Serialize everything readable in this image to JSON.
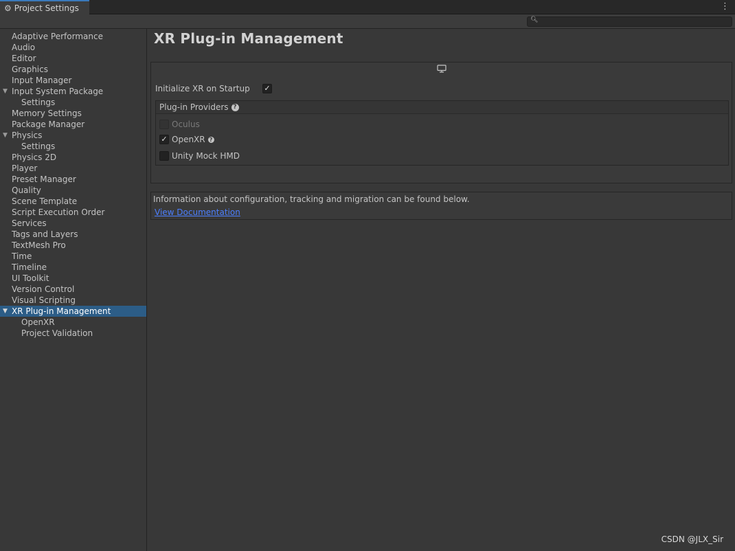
{
  "window": {
    "tab_title": "Project Settings",
    "tab_icon": "gear-icon",
    "menu_icon": "kebab-menu-icon"
  },
  "search": {
    "icon": "search-icon",
    "value": "",
    "placeholder": ""
  },
  "sidebar": {
    "items": [
      {
        "label": "Adaptive Performance",
        "level": 0
      },
      {
        "label": "Audio",
        "level": 0
      },
      {
        "label": "Editor",
        "level": 0
      },
      {
        "label": "Graphics",
        "level": 0
      },
      {
        "label": "Input Manager",
        "level": 0
      },
      {
        "label": "Input System Package",
        "level": 0,
        "expanded": true
      },
      {
        "label": "Settings",
        "level": 1
      },
      {
        "label": "Memory Settings",
        "level": 0
      },
      {
        "label": "Package Manager",
        "level": 0
      },
      {
        "label": "Physics",
        "level": 0,
        "expanded": true
      },
      {
        "label": "Settings",
        "level": 1
      },
      {
        "label": "Physics 2D",
        "level": 0
      },
      {
        "label": "Player",
        "level": 0
      },
      {
        "label": "Preset Manager",
        "level": 0
      },
      {
        "label": "Quality",
        "level": 0
      },
      {
        "label": "Scene Template",
        "level": 0
      },
      {
        "label": "Script Execution Order",
        "level": 0
      },
      {
        "label": "Services",
        "level": 0
      },
      {
        "label": "Tags and Layers",
        "level": 0
      },
      {
        "label": "TextMesh Pro",
        "level": 0
      },
      {
        "label": "Time",
        "level": 0
      },
      {
        "label": "Timeline",
        "level": 0
      },
      {
        "label": "UI Toolkit",
        "level": 0
      },
      {
        "label": "Version Control",
        "level": 0
      },
      {
        "label": "Visual Scripting",
        "level": 0
      },
      {
        "label": "XR Plug-in Management",
        "level": 0,
        "expanded": true,
        "selected": true
      },
      {
        "label": "OpenXR",
        "level": 1
      },
      {
        "label": "Project Validation",
        "level": 1
      }
    ]
  },
  "main": {
    "title": "XR Plug-in Management",
    "platform_icon": "desktop-monitor-icon",
    "init_xr": {
      "label": "Initialize XR on Startup",
      "checked": true
    },
    "providers": {
      "header": "Plug-in Providers",
      "items": [
        {
          "label": "Oculus",
          "checked": false,
          "disabled": true,
          "help": false
        },
        {
          "label": "OpenXR",
          "checked": true,
          "disabled": false,
          "help": true
        },
        {
          "label": "Unity Mock HMD",
          "checked": false,
          "disabled": false,
          "help": false
        }
      ]
    },
    "info": {
      "text": "Information about configuration, tracking and migration can be found below.",
      "link": "View Documentation"
    }
  },
  "watermark": "CSDN @JLX_Sir",
  "colors": {
    "background": "#383838",
    "selection": "#2c5d87",
    "tab_accent": "#3a79bb",
    "link": "#4c7fff"
  }
}
